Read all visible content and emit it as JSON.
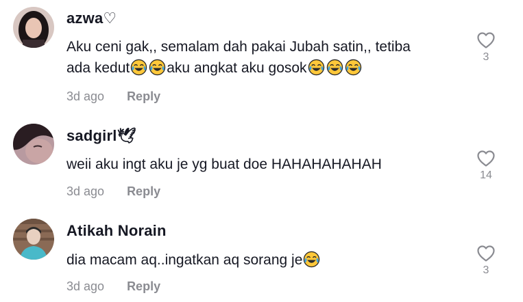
{
  "comments": [
    {
      "username": "azwa♡",
      "text_line1": "Aku ceni gak,, semalam dah pakai Jubah satin,, tetiba",
      "text_line2_a": "ada kedut",
      "text_line2_b": "aku angkat aku gosok",
      "time": "3d ago",
      "reply_label": "Reply",
      "likes": "3",
      "avatar_colors": {
        "bg": "#d8c7c2",
        "hair": "#1c1516",
        "skin": "#e9c5b4"
      }
    },
    {
      "username": "sadgirl🕊",
      "text": "weii aku ingt aku je yg buat doe HAHAHAHAHAH",
      "time": "3d ago",
      "reply_label": "Reply",
      "likes": "14",
      "avatar_colors": {
        "bg": "#b89aa0",
        "hair": "#2a1d22",
        "skin": "#c9a5a5"
      }
    },
    {
      "username": "Atikah Norain",
      "text": "dia macam aq..ingatkan aq sorang je",
      "time": "3d ago",
      "reply_label": "Reply",
      "likes": "3",
      "avatar_colors": {
        "bg": "#8a6a55",
        "shirt": "#49b9c9",
        "skin": "#e8d0c0"
      }
    }
  ],
  "emoji_name": "face-with-tears-of-joy",
  "colors": {
    "text": "#161823",
    "muted": "#8a8b91",
    "emoji_face": "#ffc83a",
    "emoji_tear": "#3fa2e0"
  }
}
